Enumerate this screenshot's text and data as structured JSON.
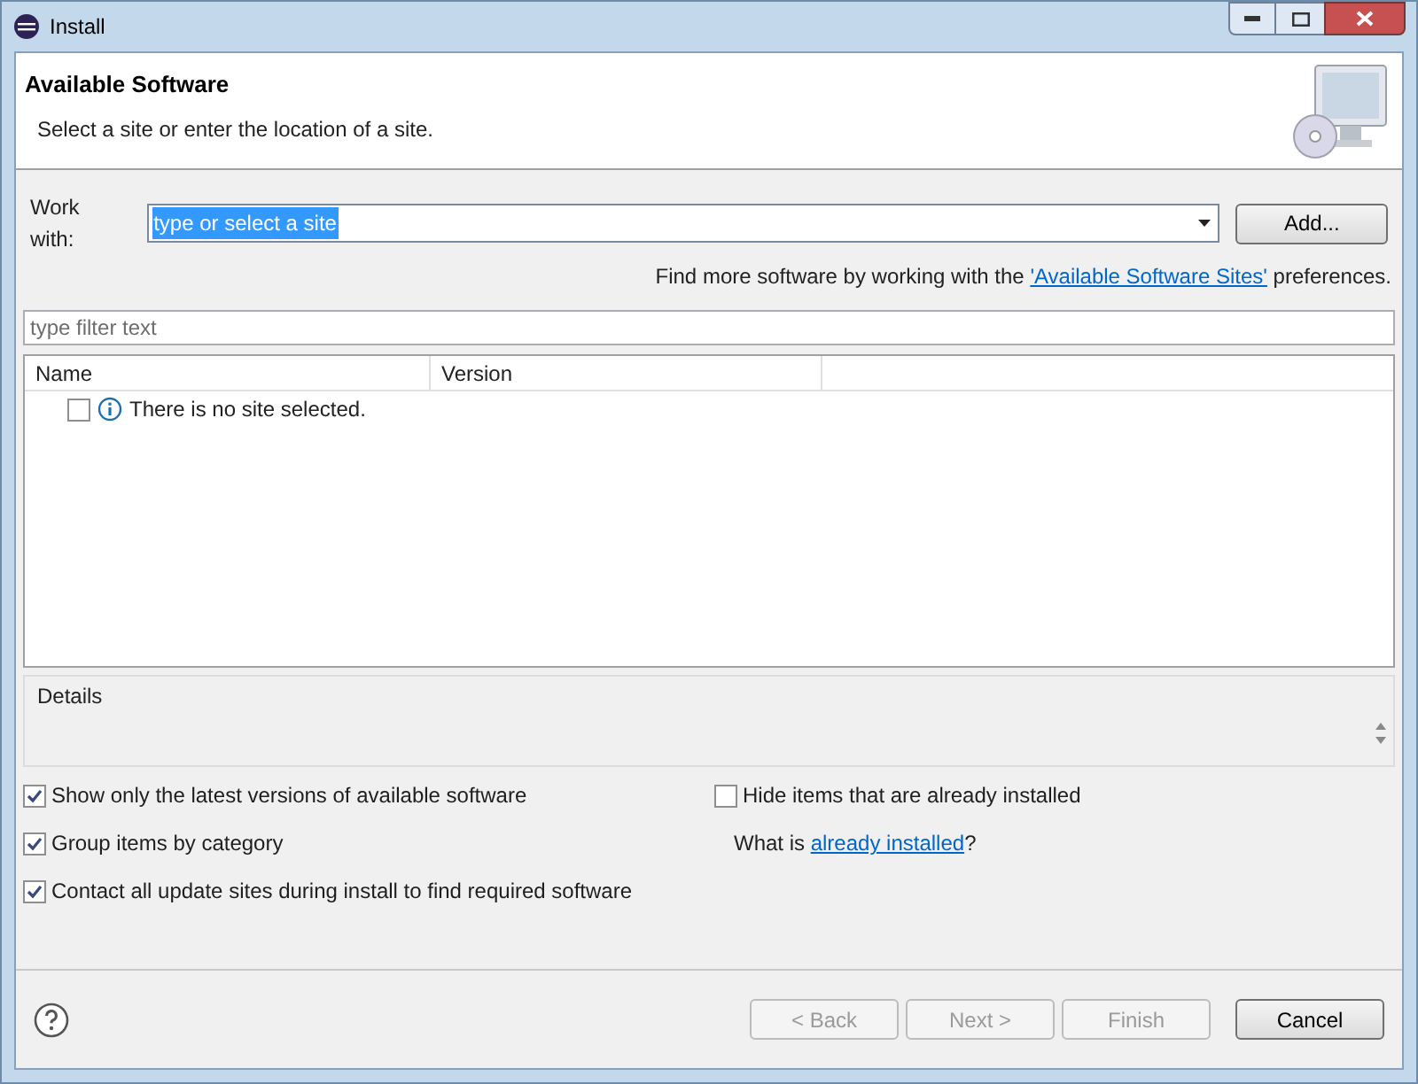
{
  "window": {
    "title": "Install"
  },
  "header": {
    "title": "Available Software",
    "subtitle": "Select a site or enter the location of a site."
  },
  "work_with": {
    "label": "Work with:",
    "value": "type or select a site",
    "button": "Add..."
  },
  "more_software": {
    "before": "Find more software by working with the",
    "link": "'Available Software Sites'",
    "after": "preferences."
  },
  "filter": {
    "placeholder": "type filter text"
  },
  "table": {
    "columns": [
      "Name",
      "Version"
    ],
    "rows": [
      {
        "name": "There is no site selected.",
        "checked": false
      }
    ]
  },
  "details": {
    "label": "Details"
  },
  "options": [
    {
      "label": "Show only the latest versions of available software",
      "checked": true
    },
    {
      "label": "Hide items that are already installed",
      "checked": false
    },
    {
      "label": "Group items by category",
      "checked": true
    },
    {
      "label": "Contact all update sites during install to find required software",
      "checked": true
    }
  ],
  "installed_hint": {
    "before": "What is",
    "link": "already installed",
    "after": "?"
  },
  "buttons": [
    {
      "label": "< Back",
      "disabled": true
    },
    {
      "label": "Next >",
      "disabled": true
    },
    {
      "label": "Finish",
      "disabled": true
    },
    {
      "label": "Cancel",
      "disabled": false
    }
  ]
}
